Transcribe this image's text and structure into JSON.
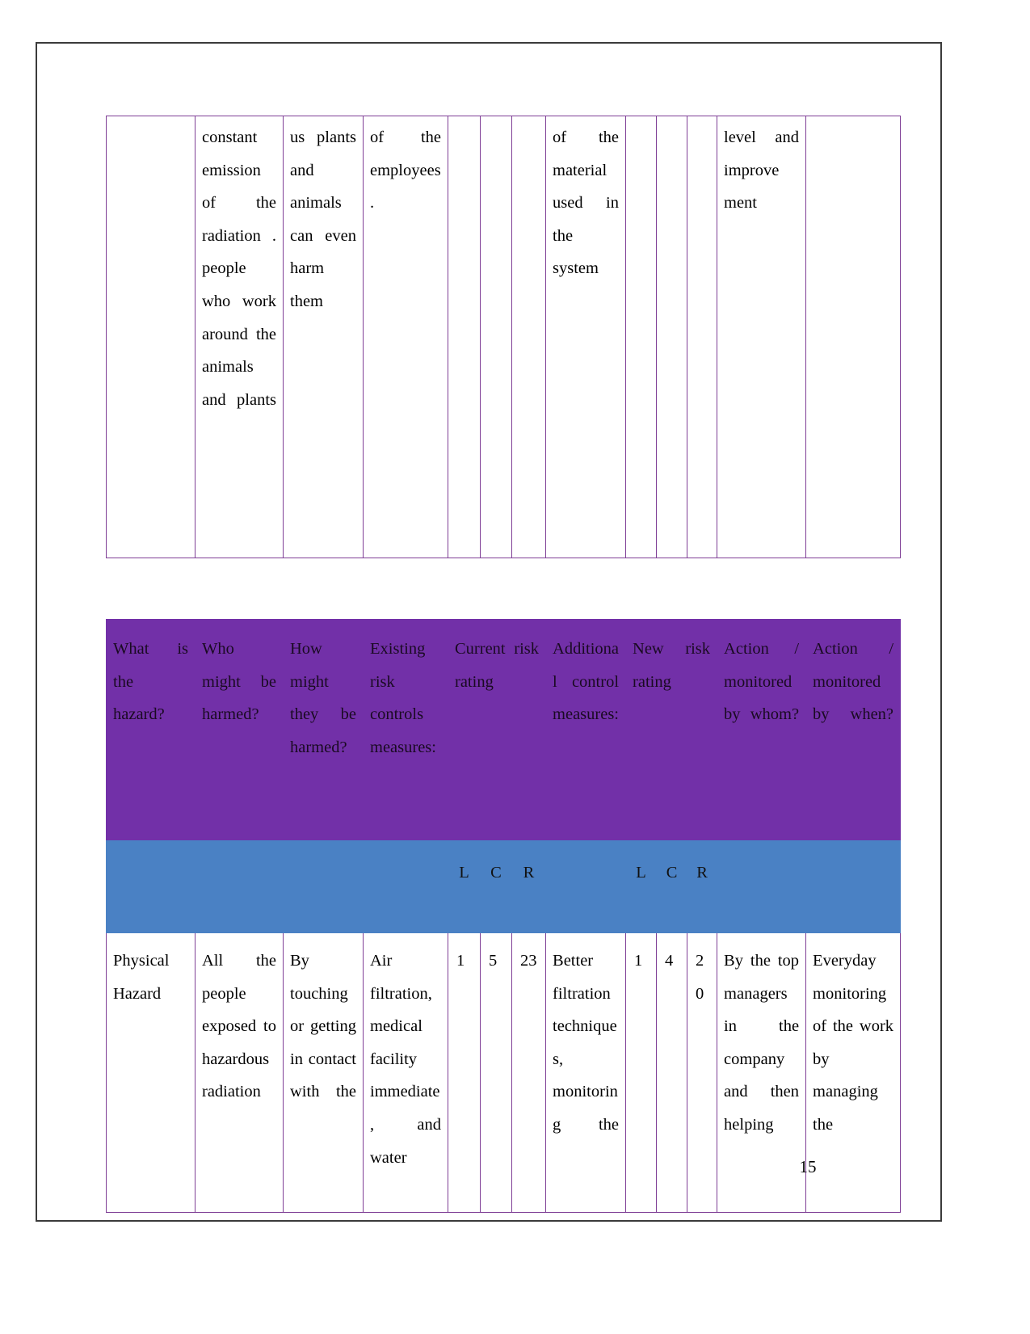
{
  "document": {
    "page_number": "15"
  },
  "table_continued": {
    "columns": 12,
    "cells": [
      "",
      "constant emission of the radiation . people who work around the animals and plants",
      "us plants and animals can even harm them",
      "of the employees.",
      "",
      "",
      "",
      "of the material used in the system",
      "",
      "",
      "",
      "level and improve ment",
      ""
    ]
  },
  "risk_table": {
    "header": [
      "What is the hazard?",
      "Who might be harmed?",
      "How might they be harmed?",
      "Existing risk controls measures:",
      "Current risk rating",
      "Additional control measures:",
      "New risk rating",
      "Action / monitored by whom?",
      "Action / monitored by when?"
    ],
    "subheader": {
      "current_l": "L",
      "current_c": "C",
      "current_r": "R",
      "new_l": "L",
      "new_c": "C",
      "new_r": "R",
      "blank": ""
    },
    "rows": [
      {
        "hazard": "Physical Hazard",
        "who_harmed": "All the people exposed to hazardous radiation",
        "how_harmed": "By touching or getting in contact with the",
        "existing_controls": "Air filtration, medical facility immediate, and water",
        "current_l": "1",
        "current_c": "5",
        "current_r": "23",
        "additional_controls": "Better filtration techniques, monitoring the",
        "new_l": "1",
        "new_c": "4",
        "new_r": "20",
        "action_by_whom": "By the top managers in the company and then helping",
        "action_by_when": "Everyday monitoring of the work by managing the"
      }
    ]
  },
  "colors": {
    "header_purple": "#7230A8",
    "subheader_blue": "#4A81C4",
    "cell_border_purple": "#7f3f96",
    "page_border": "#3b3b3b"
  }
}
